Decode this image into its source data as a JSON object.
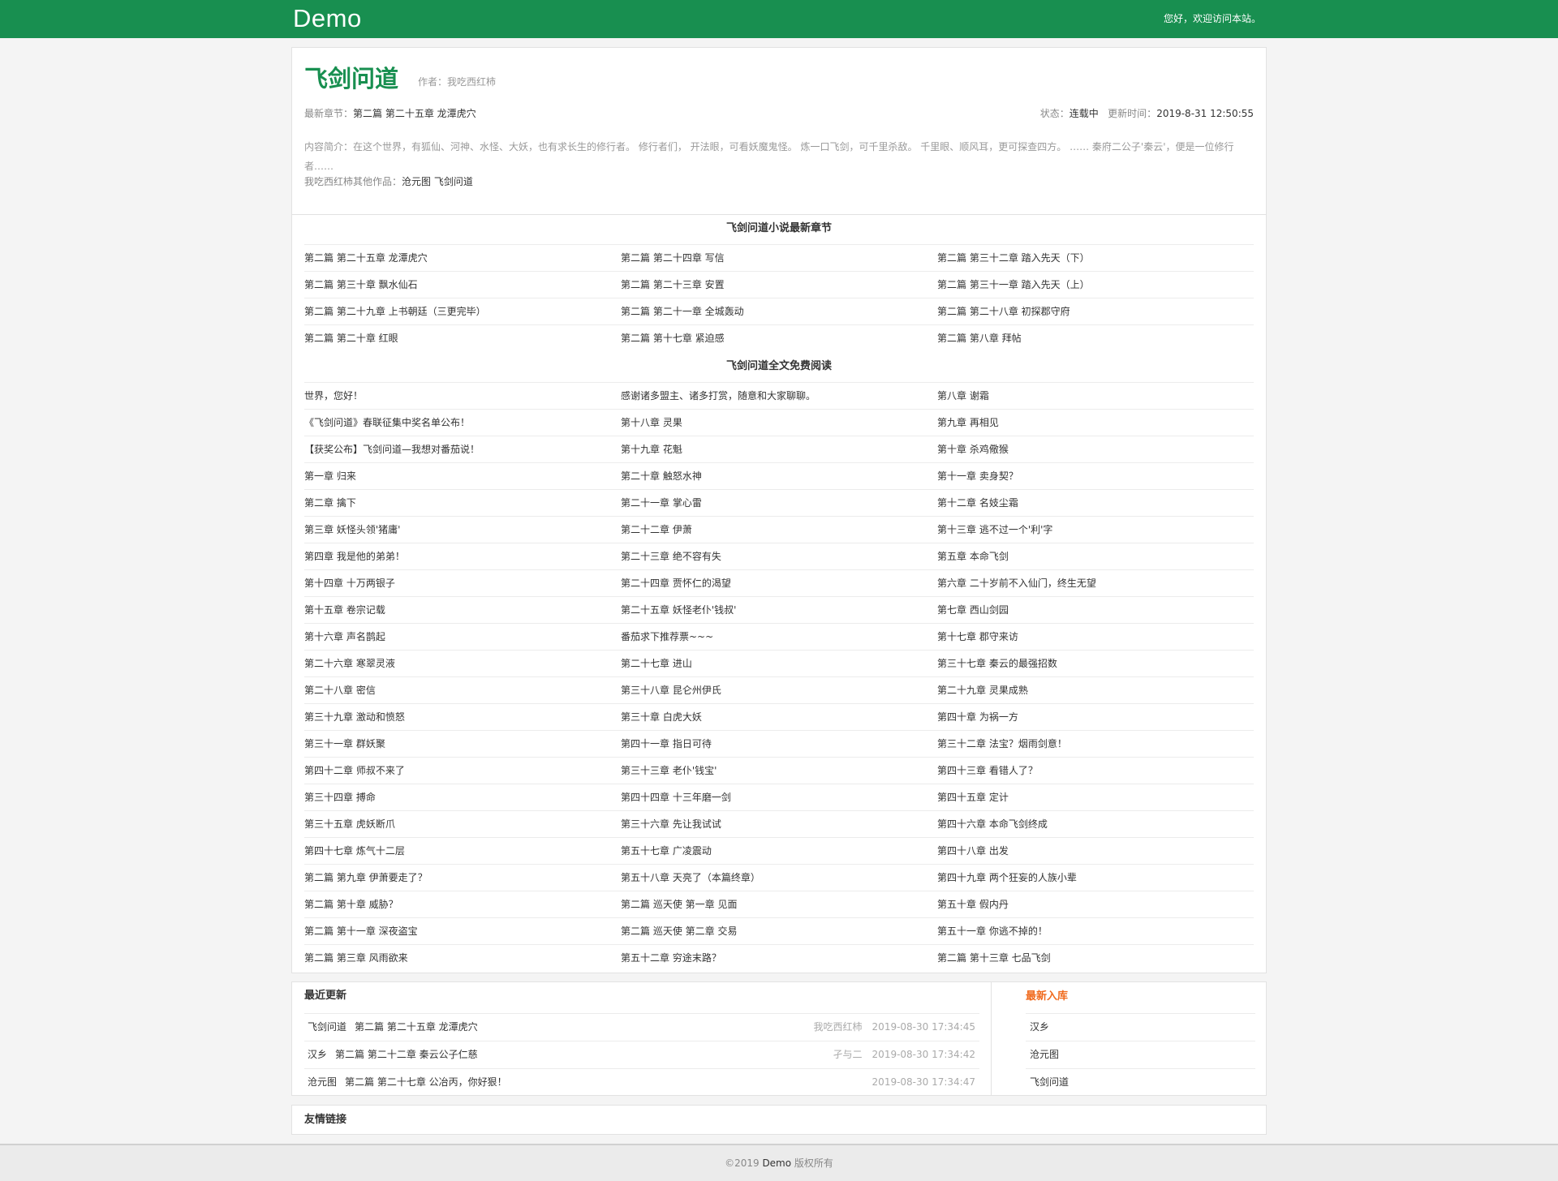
{
  "header": {
    "logo": "Demo",
    "welcome": "您好，欢迎访问本站。"
  },
  "book": {
    "title": "飞剑问道",
    "author_label": "作者：",
    "author": "我吃西红柿",
    "latest_label": "最新章节：",
    "latest_chapter": "第二篇 第二十五章 龙潭虎穴",
    "status_label": "状态：",
    "status": "连载中",
    "update_label": "更新时间：",
    "update_time": "2019-8-31 12:50:55",
    "intro_label": "内容简介：",
    "intro": "在这个世界，有狐仙、河神、水怪、大妖，也有求长生的修行者。 修行者们， 开法眼，可看妖魔鬼怪。 炼一口飞剑，可千里杀敌。 千里眼、顺风耳，更可探查四方。 …… 秦府二公子'秦云'，便是一位修行者……",
    "other_works_label": "我吃西红柿其他作品：",
    "other_works": [
      "沧元图",
      "飞剑问道"
    ]
  },
  "latest_section": {
    "title": "飞剑问道小说最新章节",
    "chapters": [
      "第二篇 第二十五章 龙潭虎穴",
      "第二篇 第二十四章 写信",
      "第二篇 第三十二章 踏入先天（下）",
      "第二篇 第三十章 飘水仙石",
      "第二篇 第二十三章 安置",
      "第二篇 第三十一章 踏入先天（上）",
      "第二篇 第二十九章 上书朝廷（三更完毕）",
      "第二篇 第二十一章 全城轰动",
      "第二篇 第二十八章 初探郡守府",
      "第二篇 第二十章 红眼",
      "第二篇 第十七章 紧迫感",
      "第二篇 第八章 拜帖"
    ]
  },
  "full_section": {
    "title": "飞剑问道全文免费阅读",
    "chapters": [
      "世界，您好！",
      "感谢诸多盟主、诸多打赏，随意和大家聊聊。",
      "第八章 谢霜",
      "《飞剑问道》春联征集中奖名单公布！",
      "第十八章 灵果",
      "第九章 再相见",
      "【获奖公布】飞剑问道—我想对番茄说！",
      "第十九章 花魁",
      "第十章 杀鸡儆猴",
      "第一章 归来",
      "第二十章 触怒水神",
      "第十一章 卖身契？",
      "第二章 擒下",
      "第二十一章 掌心雷",
      "第十二章 名妓尘霜",
      "第三章 妖怪头领'猪庸'",
      "第二十二章 伊萧",
      "第十三章 逃不过一个'利'字",
      "第四章 我是他的弟弟！",
      "第二十三章 绝不容有失",
      "第五章 本命飞剑",
      "第十四章 十万两银子",
      "第二十四章 贾怀仁的渴望",
      "第六章 二十岁前不入仙门，终生无望",
      "第十五章 卷宗记载",
      "第二十五章 妖怪老仆'钱叔'",
      "第七章 西山剑园",
      "第十六章 声名鹊起",
      "番茄求下推荐票~~~",
      "第十七章 郡守来访",
      "第二十六章 寒翠灵液",
      "第二十七章 进山",
      "第三十七章 秦云的最强招数",
      "第二十八章 密信",
      "第三十八章 昆仑州伊氏",
      "第二十九章 灵果成熟",
      "第三十九章 激动和愤怒",
      "第三十章 白虎大妖",
      "第四十章 为祸一方",
      "第三十一章 群妖聚",
      "第四十一章 指日可待",
      "第三十二章 法宝？烟雨剑意！",
      "第四十二章 师叔不来了",
      "第三十三章 老仆'钱宝'",
      "第四十三章 看错人了？",
      "第三十四章 搏命",
      "第四十四章 十三年磨一剑",
      "第四十五章 定计",
      "第三十五章 虎妖断爪",
      "第三十六章 先让我试试",
      "第四十六章 本命飞剑终成",
      "第四十七章 炼气十二层",
      "第五十七章 广凌震动",
      "第四十八章 出发",
      "第二篇 第九章 伊萧要走了？",
      "第五十八章 天亮了（本篇终章）",
      "第四十九章 两个狂妄的人族小辈",
      "第二篇 第十章 威胁？",
      "第二篇 巡天使 第一章 见面",
      "第五十章 假内丹",
      "第二篇 第十一章 深夜盗宝",
      "第二篇 巡天使 第二章 交易",
      "第五十一章 你逃不掉的！",
      "第二篇 第三章 风雨欲来",
      "第五十二章 穷途末路？",
      "第二篇 第十三章 七品飞剑"
    ]
  },
  "recent": {
    "title": "最近更新",
    "rows": [
      {
        "book": "飞剑问道",
        "chapter": "第二篇 第二十五章 龙潭虎穴",
        "author": "我吃西红柿",
        "time": "2019-08-30 17:34:45"
      },
      {
        "book": "汉乡",
        "chapter": "第二篇 第二十二章 秦云公子仁慈",
        "author": "孑与二",
        "time": "2019-08-30 17:34:42"
      },
      {
        "book": "沧元图",
        "chapter": "第二篇 第二十七章 公冶丙，你好狠！",
        "author": "",
        "time": "2019-08-30 17:34:47"
      }
    ]
  },
  "new_books": {
    "title": "最新入库",
    "items": [
      "汉乡",
      "沧元图",
      "飞剑问道"
    ]
  },
  "links": {
    "title": "友情链接"
  },
  "footer": {
    "prefix": "©2019 ",
    "brand": "Demo",
    "suffix": " 版权所有"
  },
  "colors": {
    "brand_green": "#188f50",
    "accent_orange": "#f06a1d"
  }
}
